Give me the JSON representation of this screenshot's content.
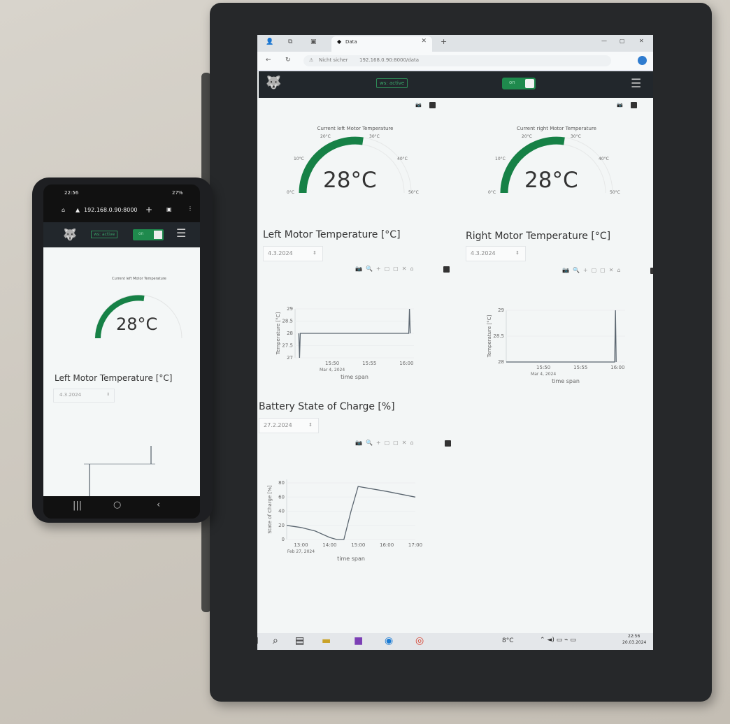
{
  "browser": {
    "tab_title": "Data",
    "address_security": "Nicht sicher",
    "address_url": "192.168.0.90:8000/data"
  },
  "app": {
    "ws_status": "ws: active",
    "toggle_label": "on"
  },
  "gauges": [
    {
      "title": "Current left Motor Temperature",
      "value": 28,
      "display": "28°C",
      "min": 0,
      "max": 50,
      "ticks": [
        "0°C",
        "10°C",
        "20°C",
        "30°C",
        "40°C",
        "50°C"
      ],
      "bar_color": "#168146"
    },
    {
      "title": "Current right Motor Temperature",
      "value": 28,
      "display": "28°C",
      "min": 0,
      "max": 50,
      "ticks": [
        "0°C",
        "10°C",
        "20°C",
        "30°C",
        "40°C",
        "50°C"
      ],
      "bar_color": "#168146"
    }
  ],
  "sections": {
    "left_temp": {
      "title": "Left Motor Temperature [°C]",
      "date": "4.3.2024"
    },
    "right_temp": {
      "title": "Right Motor Temperature [°C]",
      "date": "4.3.2024"
    },
    "battery": {
      "title": "Battery State of Charge [%]",
      "date": "27.2.2024"
    }
  },
  "chart_data": [
    {
      "type": "line",
      "title": "Left Motor Temperature [°C]",
      "xlabel": "time span",
      "ylabel": "Temperature [°C]",
      "x_ticks": [
        "15:50",
        "15:55",
        "16:00"
      ],
      "x_subtick": "Mar 4, 2024",
      "y_ticks": [
        "27",
        "27.5",
        "28",
        "28.5",
        "29"
      ],
      "ylim": [
        27,
        29
      ],
      "series": [
        {
          "values_desc": "constant 28 with dip to 27 near start and spike to 29 near end",
          "points": [
            [
              "15:45.5",
              28
            ],
            [
              "15:45.6",
              27
            ],
            [
              "15:45.7",
              28
            ],
            [
              "16:00.3",
              28
            ],
            [
              "16:00.4",
              29
            ],
            [
              "16:00.5",
              28
            ]
          ]
        }
      ]
    },
    {
      "type": "line",
      "title": "Right Motor Temperature [°C]",
      "xlabel": "time span",
      "ylabel": "Temperature [°C]",
      "x_ticks": [
        "15:50",
        "15:55",
        "16:00"
      ],
      "x_subtick": "Mar 4, 2024",
      "y_ticks": [
        "28",
        "28.5",
        "29"
      ],
      "ylim": [
        28,
        29
      ],
      "series": [
        {
          "points": [
            [
              "15:45",
              28
            ],
            [
              "15:59.6",
              28
            ],
            [
              "15:59.7",
              29
            ],
            [
              "15:59.8",
              28
            ]
          ]
        }
      ]
    },
    {
      "type": "line",
      "title": "Battery State of Charge [%]",
      "xlabel": "time span",
      "ylabel": "State of Charge [%]",
      "x_ticks": [
        "13:00",
        "14:00",
        "15:00",
        "16:00",
        "17:00"
      ],
      "x_subtick": "Feb 27, 2024",
      "y_ticks": [
        "0",
        "20",
        "40",
        "60",
        "80"
      ],
      "ylim": [
        0,
        85
      ],
      "series": [
        {
          "points": [
            [
              "12:30",
              20
            ],
            [
              "13:00",
              17
            ],
            [
              "13:30",
              12
            ],
            [
              "14:00",
              3
            ],
            [
              "14:15",
              0
            ],
            [
              "14:30",
              0
            ],
            [
              "14:45",
              40
            ],
            [
              "15:00",
              75
            ],
            [
              "16:00",
              68
            ],
            [
              "17:00",
              60
            ]
          ]
        }
      ]
    }
  ],
  "taskbar": {
    "weather": "8°C",
    "time": "22:56",
    "date": "20.03.2024"
  },
  "phone": {
    "status_time": "22:56",
    "status_right": "27%",
    "url": "192.168.0.90:8000",
    "ws_status": "ws: active",
    "toggle_label": "on",
    "gauge_title": "Current left Motor Temperature",
    "gauge_display": "28°C",
    "section_title": "Left Motor Temperature [°C]",
    "section_date": "4.3.2024"
  }
}
